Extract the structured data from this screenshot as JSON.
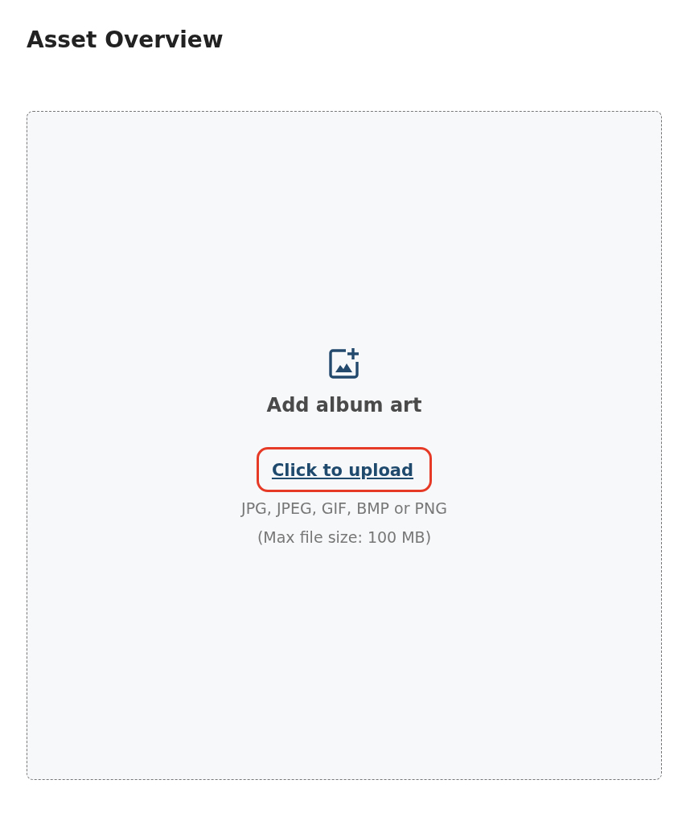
{
  "page": {
    "title": "Asset Overview"
  },
  "dropzone": {
    "heading": "Add album art",
    "upload_link": {
      "label": "Click to upload",
      "highlighted": true
    },
    "hints": [
      "JPG, JPEG, GIF, BMP or PNG",
      "(Max file size: 100 MB)"
    ]
  }
}
